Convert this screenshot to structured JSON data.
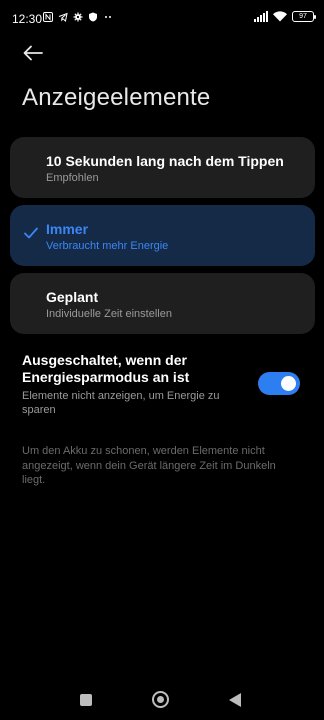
{
  "status_bar": {
    "time": "12:30",
    "left_icons": [
      "notification-n-icon",
      "telegram-icon",
      "settings-cog-icon",
      "app-shield-icon",
      "more-dots-icon"
    ],
    "right_icons": [
      "signal-icon",
      "wifi-icon",
      "battery-icon"
    ],
    "battery_level": "97"
  },
  "header": {
    "back_icon": "arrow-left-icon",
    "title": "Anzeigeelemente"
  },
  "options": [
    {
      "title": "10 Sekunden lang nach dem Tippen",
      "subtitle": "Empfohlen",
      "selected": false
    },
    {
      "title": "Immer",
      "subtitle": "Verbraucht mehr Energie",
      "selected": true
    },
    {
      "title": "Geplant",
      "subtitle": "Individuelle Zeit einstellen",
      "selected": false
    }
  ],
  "power_saving": {
    "title": "Ausgeschaltet, wenn der Energiesparmodus an ist",
    "description": "Elemente nicht anzeigen, um Energie zu sparen",
    "enabled": true
  },
  "info_text": "Um den Akku zu schonen, werden Elemente nicht angezeigt, wenn dein Gerät längere Zeit im Dunkeln liegt.",
  "nav_bar": {
    "icons": [
      "recents-square-icon",
      "home-circle-icon",
      "back-triangle-icon"
    ]
  },
  "colors": {
    "accent": "#3b86f5",
    "selected_card": "#152a47",
    "card": "#1f1f1f",
    "background": "#000000"
  }
}
